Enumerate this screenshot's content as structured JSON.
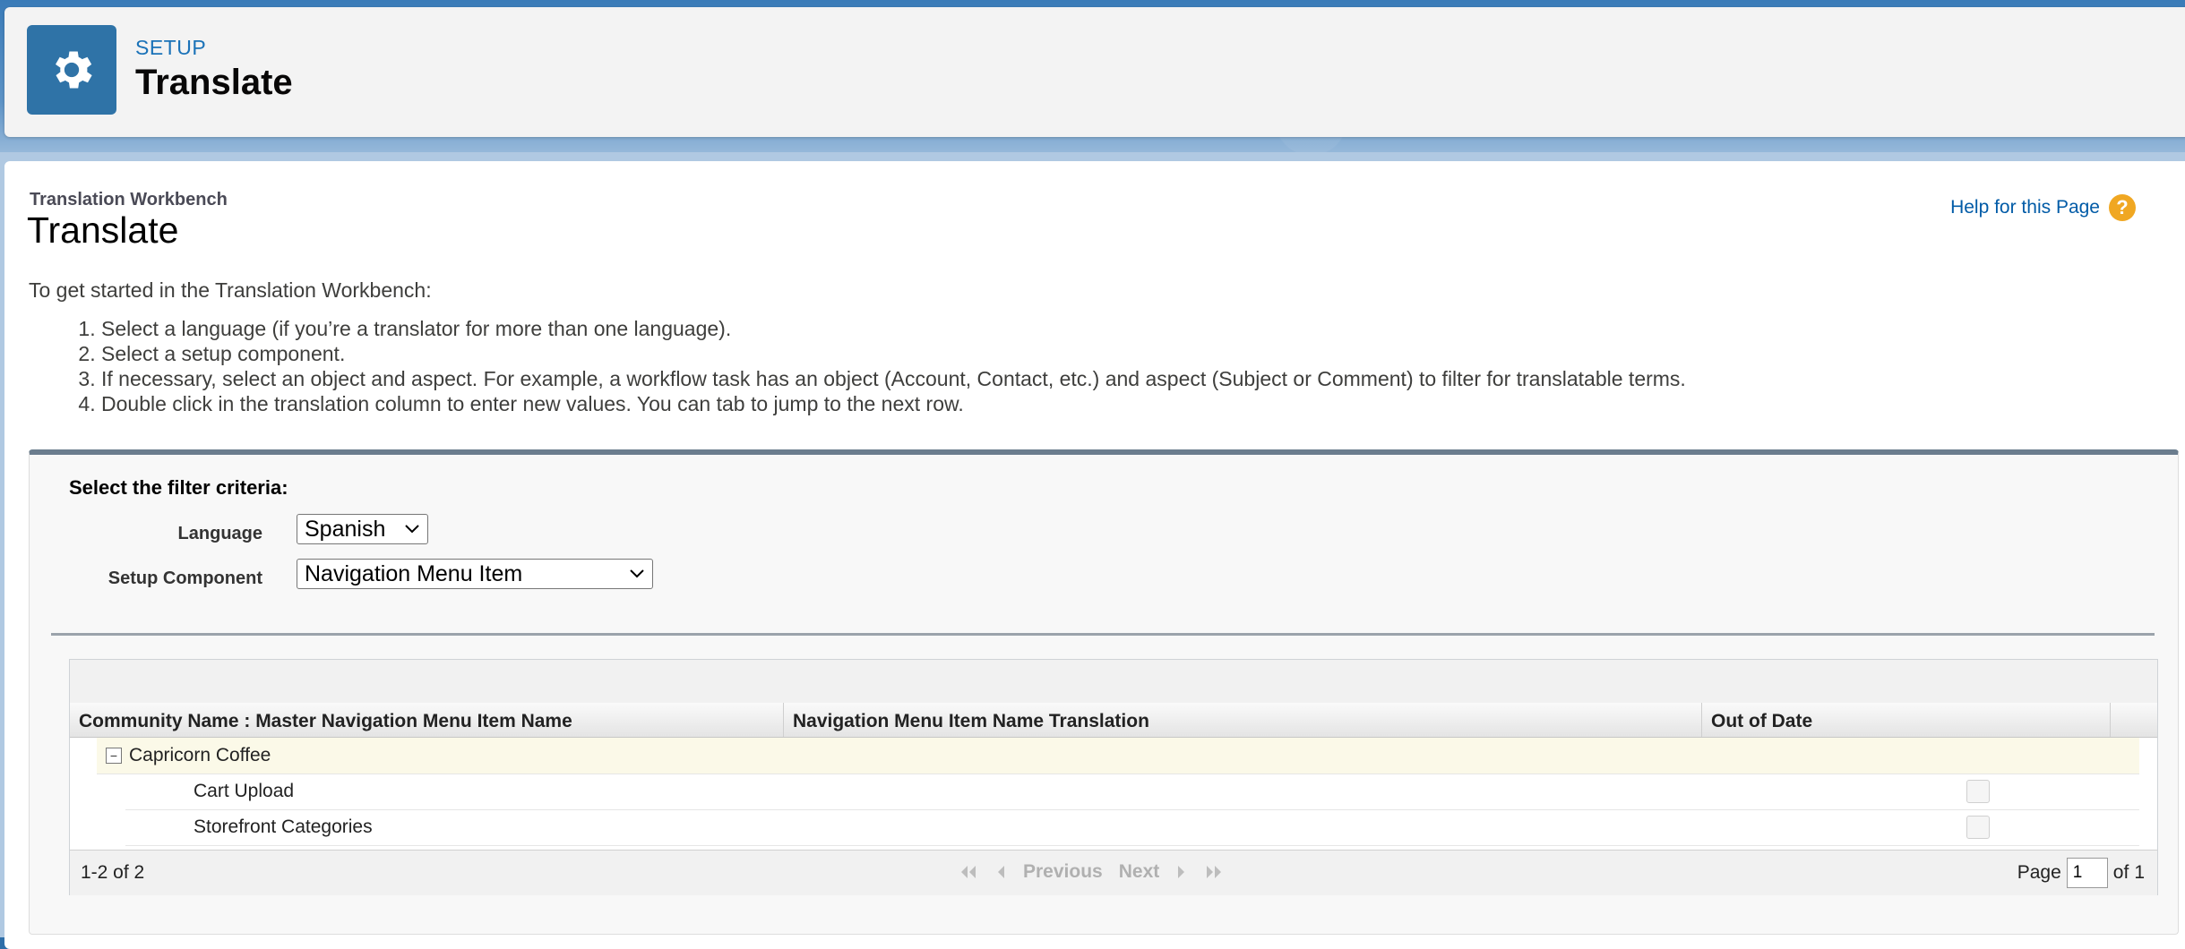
{
  "header": {
    "setup_label": "SETUP",
    "title": "Translate",
    "icon": "gear-icon"
  },
  "main": {
    "breadcrumb": "Translation Workbench",
    "title": "Translate",
    "help_link": "Help for this Page",
    "intro": "To get started in the Translation Workbench:",
    "steps": [
      "Select a language (if you’re a translator for more than one language).",
      "Select a setup component.",
      "If necessary, select an object and aspect. For example, a workflow task has an object (Account, Contact, etc.) and aspect (Subject or Comment) to filter for translatable terms.",
      "Double click in the translation column to enter new values. You can tab to jump to the next row."
    ]
  },
  "filter": {
    "title": "Select the filter criteria:",
    "language_label": "Language",
    "language_value": "Spanish",
    "component_label": "Setup Component",
    "component_value": "Navigation Menu Item"
  },
  "grid": {
    "columns": [
      "Community Name : Master Navigation Menu Item Name",
      "Navigation Menu Item Name Translation",
      "Out of Date"
    ],
    "group": "Capricorn Coffee",
    "rows": [
      {
        "name": "Cart Upload",
        "translation": "",
        "out_of_date": false
      },
      {
        "name": "Storefront Categories",
        "translation": "",
        "out_of_date": false
      }
    ],
    "count_label": "1-2 of 2",
    "previous": "Previous",
    "next": "Next",
    "page_label": "Page",
    "page_value": "1",
    "of_label": "of",
    "total_pages": "1"
  },
  "colors": {
    "accent": "#2f73a7",
    "link": "#015ba7",
    "help_icon": "#f0a722"
  }
}
